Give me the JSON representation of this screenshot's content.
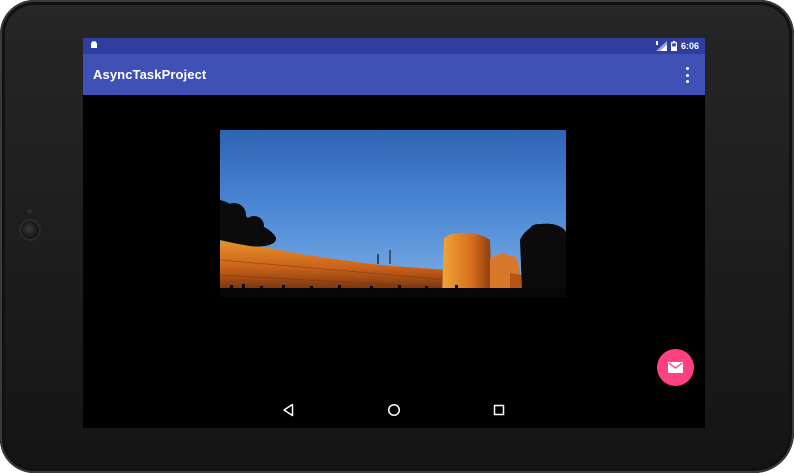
{
  "status_bar": {
    "time": "6:06",
    "left_icon": "android-icon",
    "signal_icon": "signal-icon",
    "battery_icon": "battery-icon"
  },
  "app_bar": {
    "title": "AsyncTaskProject",
    "overflow_icon": "more-vert-icon"
  },
  "content": {
    "image": "fort-wall-at-dusk-photo"
  },
  "fab": {
    "icon": "email-icon",
    "color": "#ff4081"
  },
  "nav_bar": {
    "back_icon": "back-triangle-icon",
    "home_icon": "home-circle-icon",
    "recents_icon": "recents-square-icon"
  },
  "colors": {
    "primary": "#3f51b5",
    "primary_dark": "#303f9f",
    "accent": "#ff4081"
  }
}
